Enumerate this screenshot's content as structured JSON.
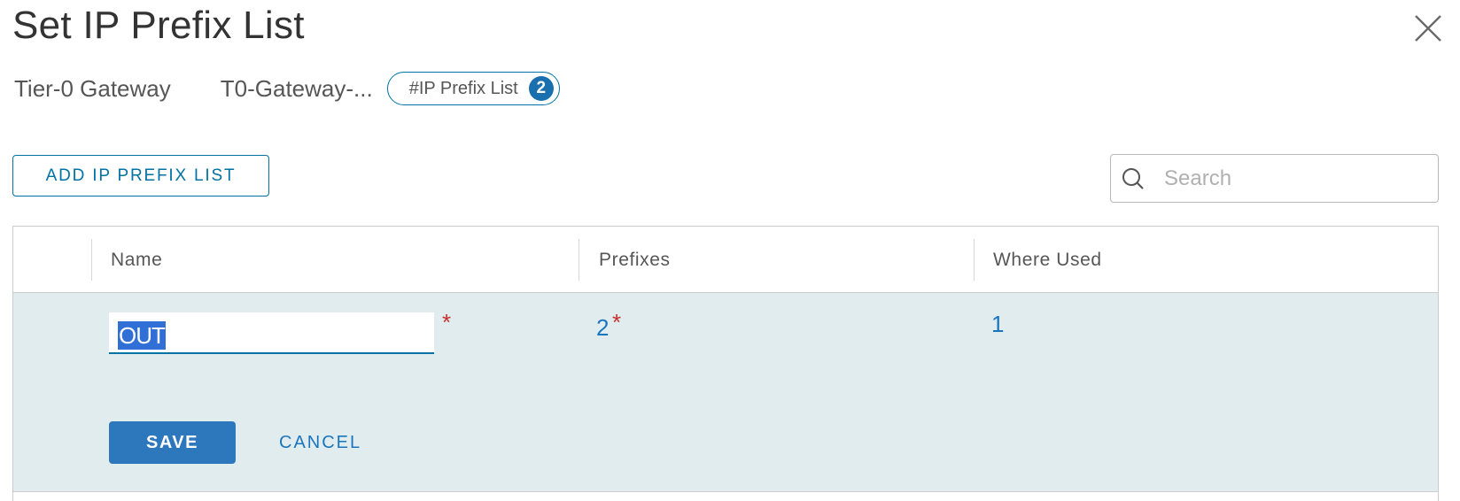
{
  "dialog": {
    "title": "Set IP Prefix List",
    "close_icon": "close-icon"
  },
  "context": {
    "label": "Tier-0 Gateway",
    "value": "T0-Gateway-...",
    "chip_label": "#IP Prefix List",
    "chip_count": "2"
  },
  "toolbar": {
    "add_label": "ADD IP PREFIX LIST",
    "search_placeholder": "Search",
    "search_icon": "search-icon"
  },
  "grid": {
    "columns": [
      "Name",
      "Prefixes",
      "Where Used"
    ],
    "edit_row": {
      "name_value": "OUT",
      "prefixes": "2",
      "where_used": "1",
      "required_marker": "*",
      "save_label": "SAVE",
      "cancel_label": "CANCEL"
    }
  },
  "colors": {
    "accent": "#0072a3",
    "link": "#1b75bc",
    "primary_button": "#2d77bd",
    "required": "#c8302f",
    "edit_row_bg": "#e1ecee"
  }
}
